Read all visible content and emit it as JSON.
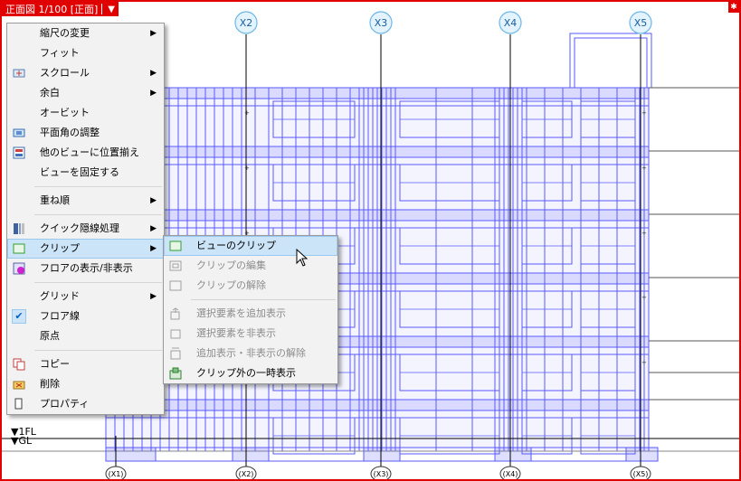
{
  "view_title": "正面図 1/100 [正面]",
  "grid_bubbles_top": [
    "X2",
    "X3",
    "X4",
    "X5"
  ],
  "grid_bubbles_bottom": [
    "X1",
    "X2",
    "X3",
    "X4",
    "X5"
  ],
  "levels": [
    "▼1FL",
    "▼GL"
  ],
  "context_menu": {
    "items": [
      {
        "label": "縮尺の変更",
        "submenu": true
      },
      {
        "label": "フィット"
      },
      {
        "label": "スクロール",
        "submenu": true,
        "icon": "scroll-icon"
      },
      {
        "label": "余白",
        "submenu": true
      },
      {
        "label": "オービット"
      },
      {
        "label": "平面角の調整",
        "icon": "plane-angle-icon"
      },
      {
        "label": "他のビューに位置揃え",
        "icon": "align-views-icon"
      },
      {
        "label": "ビューを固定する"
      },
      {
        "label": "重ね順",
        "submenu": true
      },
      {
        "label": "クイック隠線処理",
        "submenu": true,
        "icon": "hidden-line-icon"
      },
      {
        "label": "クリップ",
        "submenu": true,
        "icon": "clip-icon"
      },
      {
        "label": "フロアの表示/非表示",
        "icon": "floor-toggle-icon"
      },
      {
        "label": "グリッド",
        "submenu": true
      },
      {
        "label": "フロア線",
        "checked": true
      },
      {
        "label": "原点"
      },
      {
        "label": "コピー",
        "icon": "copy-icon"
      },
      {
        "label": "削除",
        "icon": "delete-icon"
      },
      {
        "label": "プロパティ",
        "icon": "properties-icon"
      }
    ]
  },
  "clip_submenu": {
    "items": [
      {
        "label": "ビューのクリップ",
        "highlighted": true
      },
      {
        "label": "クリップの編集",
        "disabled": true
      },
      {
        "label": "クリップの解除",
        "disabled": true
      },
      {
        "label": "選択要素を追加表示",
        "disabled": true
      },
      {
        "label": "選択要素を非表示",
        "disabled": true
      },
      {
        "label": "追加表示・非表示の解除",
        "disabled": true
      },
      {
        "label": "クリップ外の一時表示"
      }
    ]
  }
}
